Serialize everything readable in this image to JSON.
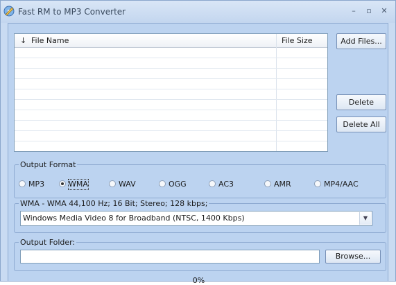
{
  "window": {
    "title": "Fast RM to MP3 Converter",
    "icon": "pencil-disc-icon"
  },
  "file_list": {
    "columns": [
      {
        "sort_glyph": "↓",
        "label": "File Name"
      },
      {
        "label": "File Size"
      }
    ],
    "rows": []
  },
  "buttons": {
    "add_files": "Add Files...",
    "delete": "Delete",
    "delete_all": "Delete All",
    "browse": "Browse..."
  },
  "output_format": {
    "label": "Output Format",
    "options": [
      "MP3",
      "WMA",
      "WAV",
      "OGG",
      "AC3",
      "AMR",
      "MP4/AAC"
    ],
    "selected": "WMA"
  },
  "profile": {
    "label": "WMA - WMA 44,100 Hz; 16 Bit; Stereo; 128 kbps;",
    "selected_value": "Windows Media Video 8 for Broadband (NTSC, 1400 Kbps)"
  },
  "output_folder": {
    "label": "Output Folder:",
    "value": ""
  },
  "progress": {
    "text": "0%"
  },
  "colors": {
    "window_bg": "#c9dbf2",
    "client_bg": "#bcd3f0",
    "border": "#8eaad1"
  }
}
